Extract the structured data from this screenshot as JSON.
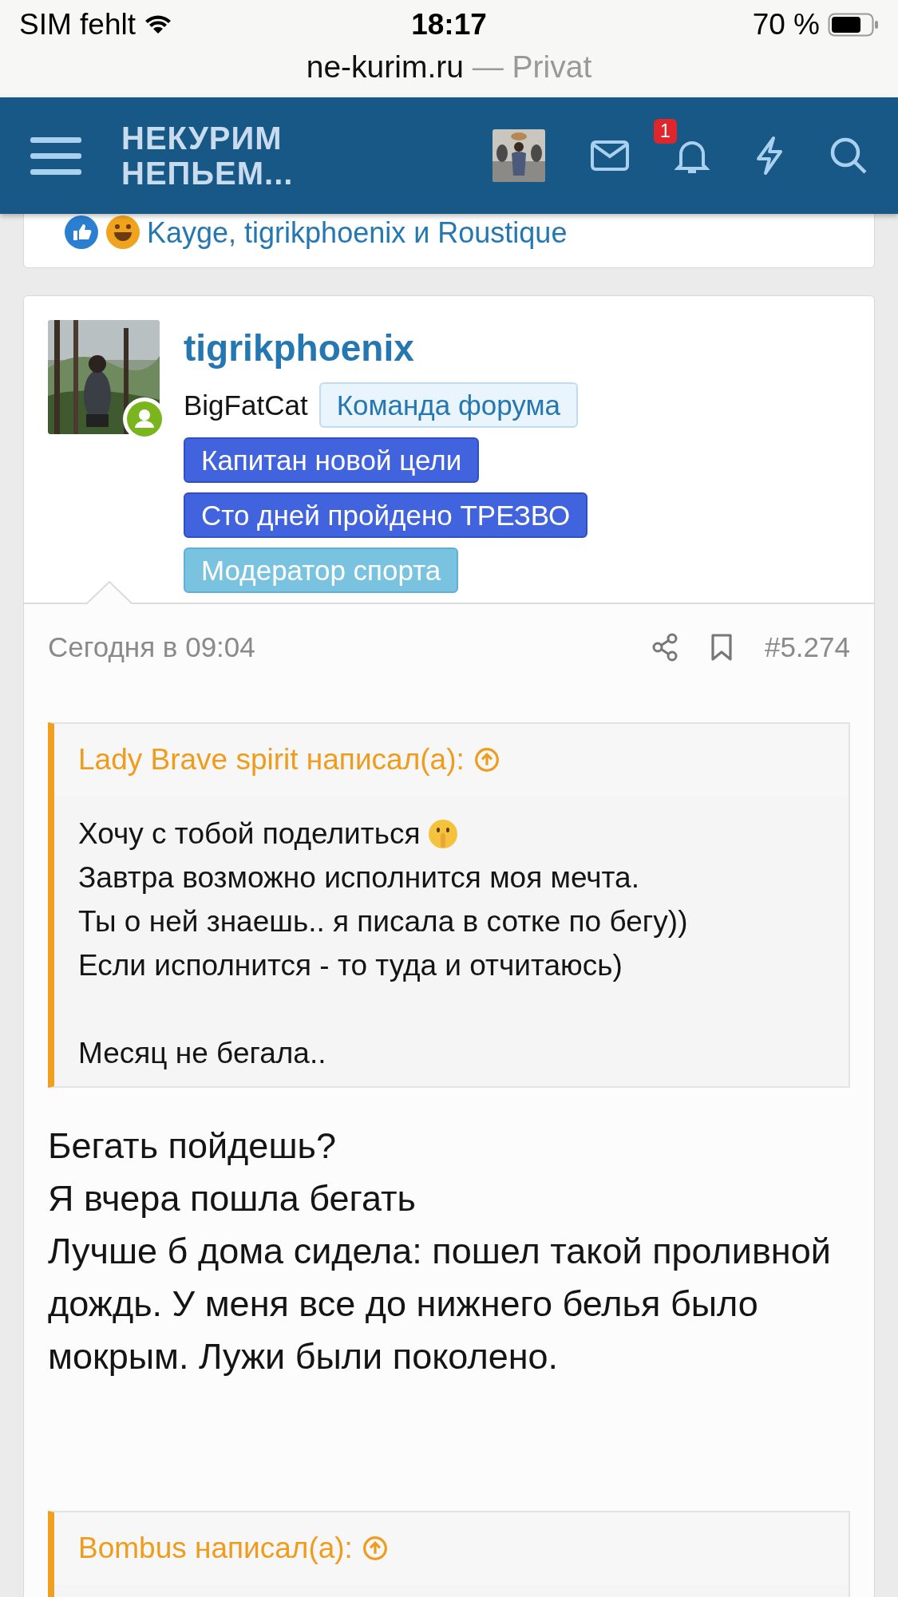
{
  "status_bar": {
    "carrier": "SIM fehlt",
    "time": "18:17",
    "battery": "70 %"
  },
  "browser": {
    "domain": "ne-kurim.ru",
    "mode": "— Privat"
  },
  "header": {
    "logo_lines": [
      "НЕКУРИМ",
      "НЕПЬЕМ..."
    ],
    "notification_count": "1"
  },
  "previous_post": {
    "reactions_text": "Kayge, tigrikphoenix и Roustique"
  },
  "post": {
    "username": "tigrikphoenix",
    "user_title": "BigFatCat",
    "banners": [
      {
        "label": "Команда форума",
        "kind": "light"
      },
      {
        "label": "Капитан новой цели",
        "kind": "blue"
      },
      {
        "label": "Сто дней пройдено ТРЕЗВО",
        "kind": "blue"
      },
      {
        "label": "Модератор спорта",
        "kind": "sky"
      }
    ],
    "date": "Сегодня в 09:04",
    "post_number": "#5.274",
    "quote": {
      "author_line": "Lady Brave spirit написал(а):",
      "paragraphs": [
        [
          "Хочу с тобой поделиться",
          "Завтра возможно исполнится моя мечта.",
          "Ты о ней знаешь.. я писала в сотке по бегу))",
          "Если исполнится - то туда и отчитаюсь)"
        ],
        [
          "Месяц не бегала.."
        ]
      ]
    },
    "body": [
      "Бегать пойдешь?",
      "Я вчера пошла бегать",
      "Лучше б дома сидела: пошел такой проливной дождь. У меня все до нижнего белья было мокрым. Лужи были поколено."
    ],
    "next_quote": {
      "author_line": "Bombus написал(а):"
    }
  }
}
